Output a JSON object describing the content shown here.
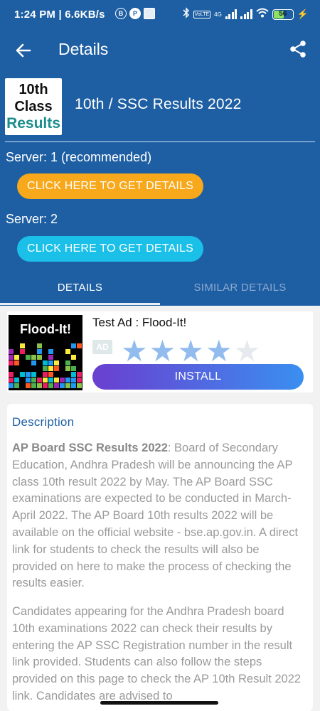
{
  "status_bar": {
    "time": "1:24 PM | 6.6KB/s",
    "network": "4G",
    "volte_label": "VoLTE",
    "battery": "56",
    "battery_level": 0.56
  },
  "app_bar": {
    "title": "Details",
    "back_icon": "arrow-left-icon",
    "share_icon": "share-icon"
  },
  "result": {
    "logo_lines": [
      "10th",
      "Class",
      "Results"
    ],
    "title": "10th / SSC Results 2022"
  },
  "servers": [
    {
      "label": "Server: 1 (recommended)",
      "button": "CLICK HERE TO GET DETAILS",
      "color": "#f7a81b"
    },
    {
      "label": "Server: 2",
      "button": "CLICK HERE TO GET DETAILS",
      "color": "#1bc0e8"
    }
  ],
  "tabs": [
    {
      "label": "DETAILS",
      "active": true
    },
    {
      "label": "SIMILAR DETAILS",
      "active": false
    }
  ],
  "ad": {
    "image_brand": "Flood-It!",
    "title": "Test Ad : Flood-It!",
    "badge": "AD",
    "rating": 4.5,
    "install_label": "INSTALL"
  },
  "description": {
    "heading": "Description",
    "p1_bold": "AP Board SSC Results 2022",
    "p1_rest": ": Board of Secondary Education, Andhra Pradesh will be announcing the AP class 10th result 2022 by May. The AP Board SSC examinations are expected to be conducted in March-April 2022.  The AP Board 10th results 2022 will be available on the official website - bse.ap.gov.in. A direct link for students to check the results will also be provided on here to make the process of checking the results easier.",
    "p2": "Candidates appearing for the Andhra Pradesh board 10th examinations 2022 can check their results by entering the AP SSC Registration number in the result link provided. Students can also follow the steps provided on this page to check the AP 10th Result 2022 link. Candidates are advised to"
  },
  "colors": {
    "header_bg": "#1e5fa3",
    "accent_orange": "#f7a81b",
    "accent_cyan": "#1bc0e8",
    "logo_teal": "#1b8c8c"
  }
}
